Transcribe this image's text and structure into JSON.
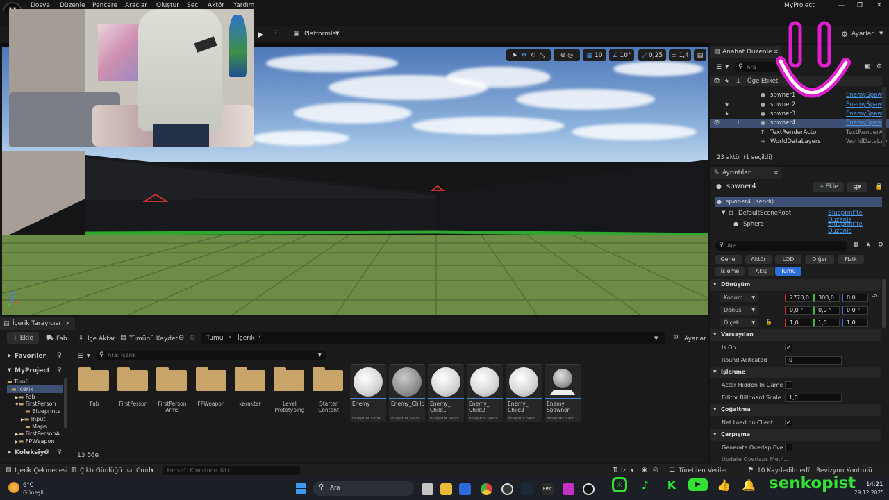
{
  "menu": {
    "items": [
      "Dosya",
      "Düzenle",
      "Pencere",
      "Araçlar",
      "Oluştur",
      "Seç",
      "Aktör",
      "Yardım"
    ],
    "project": "MyProject"
  },
  "window_controls": {
    "minimize": "—",
    "maximize": "❐",
    "close": "✕"
  },
  "toolbar": {
    "platforms": "Platformlar",
    "settings": "Ayarlar"
  },
  "viewport": {
    "grid_value": "10",
    "rotation_value": "10°",
    "scale_value": "0,25",
    "camera_speed": "1,4"
  },
  "outliner": {
    "tab": "Anahat Düzenle...",
    "search_placeholder": "Ara",
    "column_label": "Öğe Etiketi",
    "rows": [
      {
        "name": "spwner1",
        "type": "EnemySpawr"
      },
      {
        "name": "spwner2",
        "type": "EnemySpawr"
      },
      {
        "name": "spwner3",
        "type": "EnemySpawr"
      },
      {
        "name": "spwner4",
        "type": "EnemySpawr"
      },
      {
        "name": "TextRenderActor",
        "type": "TextRenderAc"
      },
      {
        "name": "WorldDataLayers",
        "type": "WorldDataLay"
      }
    ],
    "status": "23 aktör (1 seçildi)"
  },
  "details": {
    "tab": "Ayrıntılar",
    "actor": "spwner4",
    "add_button": "Ekle",
    "self_row": "spwner4 (Kendi)",
    "components": [
      {
        "name": "DefaultSceneRoot",
        "link": "Blueprint'te Düzenle"
      },
      {
        "name": "Sphere",
        "link": "Blueprint'te Düzenle"
      }
    ],
    "search_placeholder": "Ara",
    "filters_row1": [
      "Genel",
      "Aktör",
      "LOD",
      "Diğer",
      "Fizik"
    ],
    "filters_row2": [
      "İşleme",
      "Akış",
      "Tümü"
    ],
    "sections": {
      "transform": "Dönüşüm",
      "default": "Varsayılan",
      "rendering": "İşlenme",
      "replication": "Çoğaltma",
      "collision": "Çarpışma"
    },
    "transform": {
      "location_label": "Konum",
      "location": [
        "2770,0",
        "300,0",
        "0,0"
      ],
      "rotation_label": "Dönüş",
      "rotation": [
        "0,0 °",
        "0,0 °",
        "0,0 °"
      ],
      "scale_label": "Ölçek",
      "scale": [
        "1,0",
        "1,0",
        "1,0"
      ]
    },
    "is_on_label": "Is On",
    "round_label": "Round Acitcated",
    "round_value": "0",
    "hidden_label": "Actor Hidden In Game",
    "billboard_label": "Editor Billboard Scale",
    "billboard_value": "1,0",
    "net_load_label": "Net Load on Client",
    "overlap_label": "Generate Overlap Eve...",
    "overlap2_label": "Update Overlaps Meth..."
  },
  "content_browser": {
    "tab": "İçerik Tarayıcısı",
    "add": "Ekle",
    "fab": "Fab",
    "import": "İçe Aktar",
    "save_all": "Tümünü Kaydet",
    "path": [
      "Tümü",
      "İçerik"
    ],
    "settings": "Ayarlar",
    "favorites": "Favoriler",
    "project": "MyProject",
    "collections": "Koleksiyo",
    "search_placeholder": "Ara: İçerik",
    "tree": [
      "Tümü",
      "İçerik",
      "Fab",
      "FirstPerson",
      "Blueprints",
      "Input",
      "Maps",
      "FirstPersonA",
      "FPWeapon"
    ],
    "folders": [
      "Fab",
      "FirstPerson",
      "FirstPerson Arms",
      "FPWeapon",
      "karakter",
      "Level Prototyping",
      "Starter Content"
    ],
    "assets": [
      {
        "name": "Enemy",
        "type": "Blueprint Sınıfı"
      },
      {
        "name": "Enemy_Child",
        "type": "Blueprint Sınıfı"
      },
      {
        "name": "Enemy_ Child1",
        "type": "Blueprint Sınıfı"
      },
      {
        "name": "Enemy_ Child2",
        "type": "Blueprint Sınıfı"
      },
      {
        "name": "Enemy_ Child3",
        "type": "Blueprint Sınıfı"
      },
      {
        "name": "Enemy Spawner",
        "type": "Blueprint Sınıfı"
      }
    ],
    "count": "13 öğe"
  },
  "statusbar": {
    "drawer": "İçerik Çekmecesi",
    "output": "Çıktı Günlüğü",
    "cmd": "Cmd",
    "console_placeholder": "Konsol Komutunu Gir",
    "derived": "Türetilen Veriler",
    "unsaved": "10 Kaydedilmedi",
    "revision": "Revizyon Kontrolü",
    "iz": "İz"
  },
  "taskbar": {
    "temp": "6°C",
    "weather": "Güneşli",
    "search": "Ara",
    "time": "14:21",
    "date": "29.12.2025"
  },
  "overlay": {
    "brand": "senkopist"
  }
}
